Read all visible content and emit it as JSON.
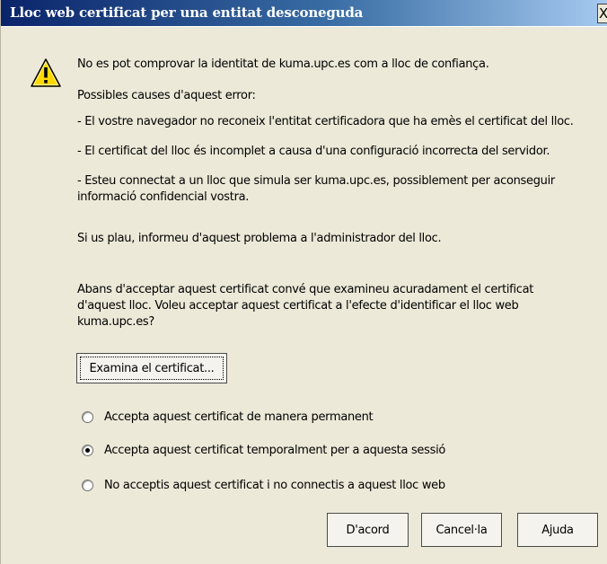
{
  "dialog": {
    "title": "Lloc web certificat per una entitat desconeguda",
    "close_glyph": "X",
    "icon": "warning-icon",
    "colors": {
      "titlebar_start": "#0a246a",
      "titlebar_end": "#a6caf0",
      "background": "#ece9d8",
      "warning_yellow": "#ffd800"
    }
  },
  "message": {
    "line1": "No es pot comprovar la identitat de kuma.upc.es com a lloc de confiança.",
    "causes_heading": "Possibles causes d'aquest error:",
    "cause1": "- El vostre navegador no reconeix l'entitat certificadora que ha emès el certificat del lloc.",
    "cause2": "- El certificat del lloc és incomplet a causa d'una configuració incorrecta del servidor.",
    "cause3": "- Esteu connectat a un lloc que simula ser kuma.upc.es, possiblement per aconseguir informació confidencial vostra.",
    "report": "Si us plau, informeu d'aquest problema a l'administrador del lloc.",
    "question": "Abans d'acceptar aquest certificat convé que examineu acuradament el certificat d'aquest lloc. Voleu acceptar aquest certificat a l'efecte d'identificar el lloc web kuma.upc.es?"
  },
  "examine_button": "Examina el certificat...",
  "options": [
    {
      "label": "Accepta aquest certificat de manera permanent",
      "checked": false
    },
    {
      "label": "Accepta aquest certificat temporalment per a aquesta sessió",
      "checked": true
    },
    {
      "label": "No acceptis aquest certificat i no connectis a aquest lloc web",
      "checked": false
    }
  ],
  "buttons": {
    "ok": "D'acord",
    "cancel": "Cancel·la",
    "help": "Ajuda"
  }
}
